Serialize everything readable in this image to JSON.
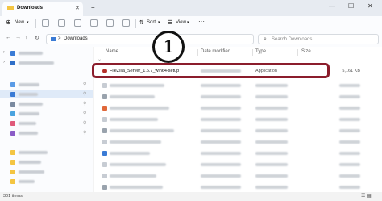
{
  "window": {
    "tab_title": "Downloads",
    "tab_close": "✕",
    "new_tab": "+",
    "minimize": "—",
    "maximize": "☐",
    "close": "✕"
  },
  "toolbar": {
    "new_label": "New",
    "sort_label": "Sort",
    "view_label": "View",
    "more": "···"
  },
  "address": {
    "back": "←",
    "forward": "→",
    "up": "↑",
    "refresh": "↻",
    "path_separator": ">",
    "path": "Downloads",
    "search_placeholder": "Search Downloads",
    "search_icon": "⌕"
  },
  "columns": {
    "name": "Name",
    "date_modified": "Date modified",
    "type": "Type",
    "size": "Size"
  },
  "files": [
    {
      "name": "FileZilla_Server_1.6.7_win64-setup",
      "type": "Application",
      "size": "5,161 KB"
    }
  ],
  "callout": {
    "number": "1"
  },
  "status": {
    "item_count": "301 items"
  },
  "colors": {
    "highlight_border": "#8b1d2c",
    "folder": "#f4c542",
    "accent": "#3a7bd5"
  }
}
